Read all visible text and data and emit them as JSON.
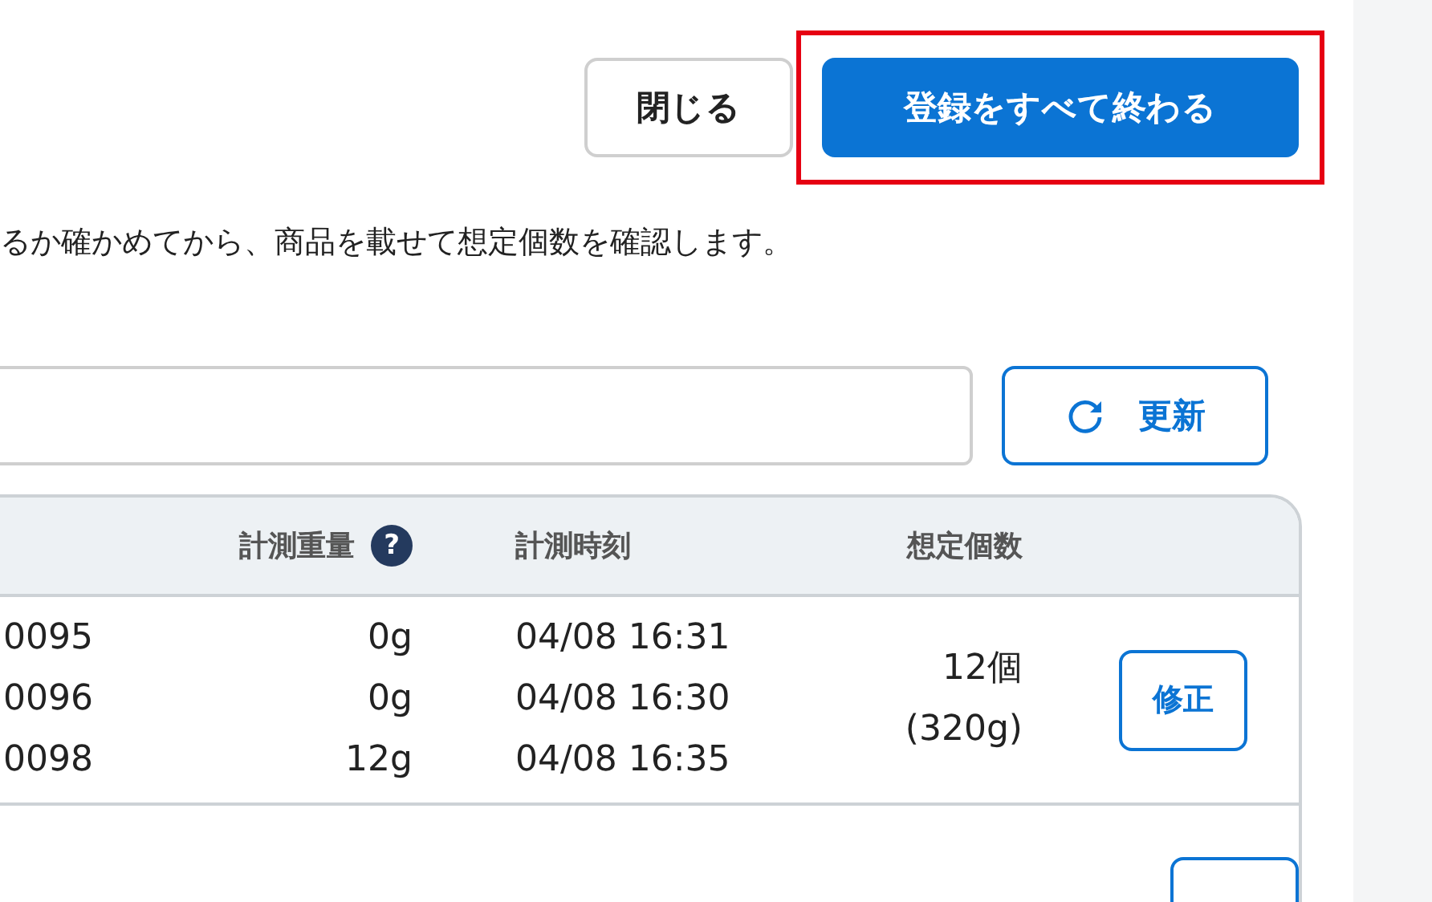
{
  "header_buttons": [
    {
      "label": "閉じる",
      "kind": "secondary",
      "highlighted": false
    },
    {
      "label": "登録をすべて終わる",
      "kind": "primary",
      "highlighted": true
    }
  ],
  "instruction": "るか確かめてから、商品を載せて想定個数を確認します。",
  "search": {
    "kind": "text"
  },
  "refresh_button": {
    "label": "更新"
  },
  "table": {
    "columns": [
      {
        "label": "計測重量",
        "help": "?"
      },
      {
        "label": "計測時刻"
      },
      {
        "label": "想定個数"
      }
    ],
    "rows": [
      {
        "measurements": [
          {
            "id": "0095",
            "weight": "0g",
            "time": "04/08 16:31"
          },
          {
            "id": "0096",
            "weight": "0g",
            "time": "04/08 16:30"
          },
          {
            "id": "0098",
            "weight": "12g",
            "time": "04/08 16:35"
          }
        ],
        "count": "12個",
        "count_weight": "(320g)",
        "edit": "修正"
      },
      {
        "edit_cut": true
      }
    ]
  }
}
